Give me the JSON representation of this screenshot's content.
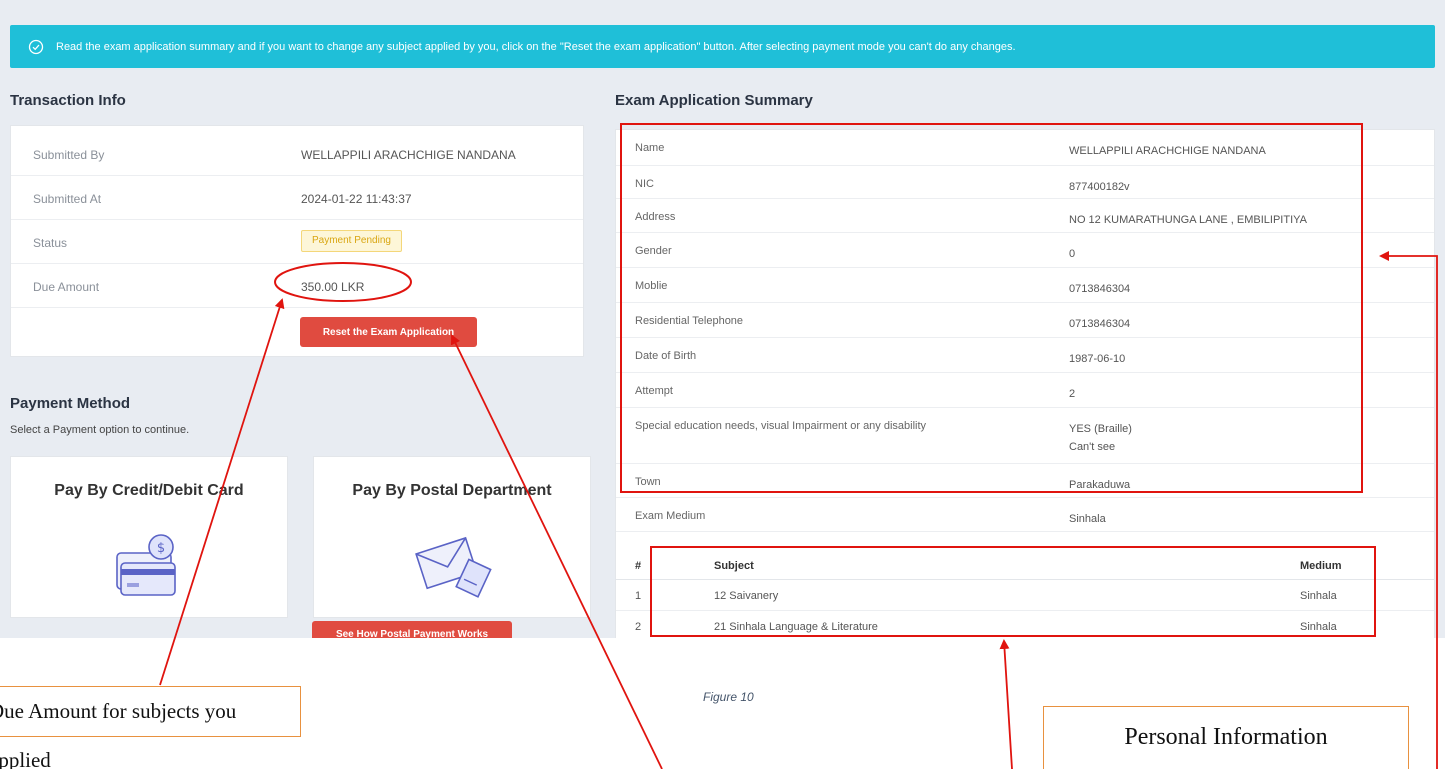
{
  "alert": {
    "message": "Read the exam application summary and if you want to change any subject applied by you, click on the \"Reset the exam application\" button. After selecting payment mode you can't do any changes."
  },
  "transaction": {
    "title": "Transaction Info",
    "rows": [
      {
        "label": "Submitted By",
        "value": "WELLAPPILI ARACHCHIGE NANDANA"
      },
      {
        "label": "Submitted At",
        "value": "2024-01-22 11:43:37"
      },
      {
        "label": "Status",
        "value": "Payment Pending"
      },
      {
        "label": "Due Amount",
        "value": "350.00 LKR"
      }
    ],
    "reset_label": "Reset the Exam Application"
  },
  "payment": {
    "title": "Payment Method",
    "subtitle": "Select a Payment option to continue.",
    "card_label": "Pay By Credit/Debit Card",
    "postal_label": "Pay By Postal Department",
    "postal_button": "See How Postal Payment Works"
  },
  "summary": {
    "title": "Exam Application Summary",
    "rows": [
      {
        "label": "Name",
        "value": "WELLAPPILI ARACHCHIGE NANDANA"
      },
      {
        "label": "NIC",
        "value": "877400182v"
      },
      {
        "label": "Address",
        "value": "NO 12 KUMARATHUNGA LANE , EMBILIPITIYA"
      },
      {
        "label": "Gender",
        "value": "0"
      },
      {
        "label": "Moblie",
        "value": "0713846304"
      },
      {
        "label": "Residential Telephone",
        "value": "0713846304"
      },
      {
        "label": "Date of Birth",
        "value": "1987-06-10"
      },
      {
        "label": "Attempt",
        "value": "2"
      },
      {
        "label": "Special education needs, visual Impairment or any disability",
        "value": "YES (Braille)",
        "value2": "Can't see"
      },
      {
        "label": "Town",
        "value": "Parakaduwa"
      },
      {
        "label": "Exam Medium",
        "value": "Sinhala"
      }
    ],
    "subjects_header": {
      "num": "#",
      "subject": "Subject",
      "medium": "Medium"
    },
    "subjects": [
      {
        "num": "1",
        "subject": "12 Saivanery",
        "medium": "Sinhala"
      },
      {
        "num": "2",
        "subject": "21 Sinhala Language & Literature",
        "medium": "Sinhala"
      }
    ]
  },
  "annotations": {
    "due_amount_callout": "Due Amount for subjects you applied",
    "personal_info_callout": "Personal Information",
    "figure_caption": "Figure 10"
  },
  "colors": {
    "alert": "#1fbfd8",
    "danger": "#e04b40",
    "annotation": "#e0140f",
    "callout_border": "#e8913f"
  }
}
